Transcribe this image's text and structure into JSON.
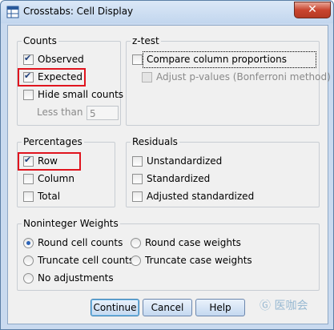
{
  "window": {
    "title": "Crosstabs: Cell Display",
    "close_label": "✕"
  },
  "counts": {
    "legend": "Counts",
    "observed": {
      "label": "Observed",
      "checked": true
    },
    "expected": {
      "label": "Expected",
      "checked": true
    },
    "hide_small": {
      "label": "Hide small counts",
      "checked": false
    },
    "less_than_label": "Less than",
    "less_than_value": "5"
  },
  "ztest": {
    "legend": "z-test",
    "compare": {
      "label": "Compare column proportions",
      "checked": false
    },
    "adjust": {
      "label": "Adjust p-values (Bonferroni method)",
      "checked": false,
      "disabled": true
    }
  },
  "percentages": {
    "legend": "Percentages",
    "row": {
      "label": "Row",
      "checked": true
    },
    "column": {
      "label": "Column",
      "checked": false
    },
    "total": {
      "label": "Total",
      "checked": false
    }
  },
  "residuals": {
    "legend": "Residuals",
    "unstandardized": {
      "label": "Unstandardized",
      "checked": false
    },
    "standardized": {
      "label": "Standardized",
      "checked": false
    },
    "adjusted": {
      "label": "Adjusted standardized",
      "checked": false
    }
  },
  "noninteger": {
    "legend": "Noninteger Weights",
    "round_cell": {
      "label": "Round cell counts",
      "selected": true
    },
    "round_case": {
      "label": "Round case weights",
      "selected": false
    },
    "truncate_cell": {
      "label": "Truncate cell counts",
      "selected": false
    },
    "truncate_case": {
      "label": "Truncate case weights",
      "selected": false
    },
    "no_adjust": {
      "label": "No adjustments",
      "selected": false
    }
  },
  "buttons": {
    "continue": "Continue",
    "cancel": "Cancel",
    "help": "Help"
  },
  "watermark": "Ⓖ 医咖会",
  "colors": {
    "highlight": "#e0141e",
    "accent": "#2b63b8"
  }
}
